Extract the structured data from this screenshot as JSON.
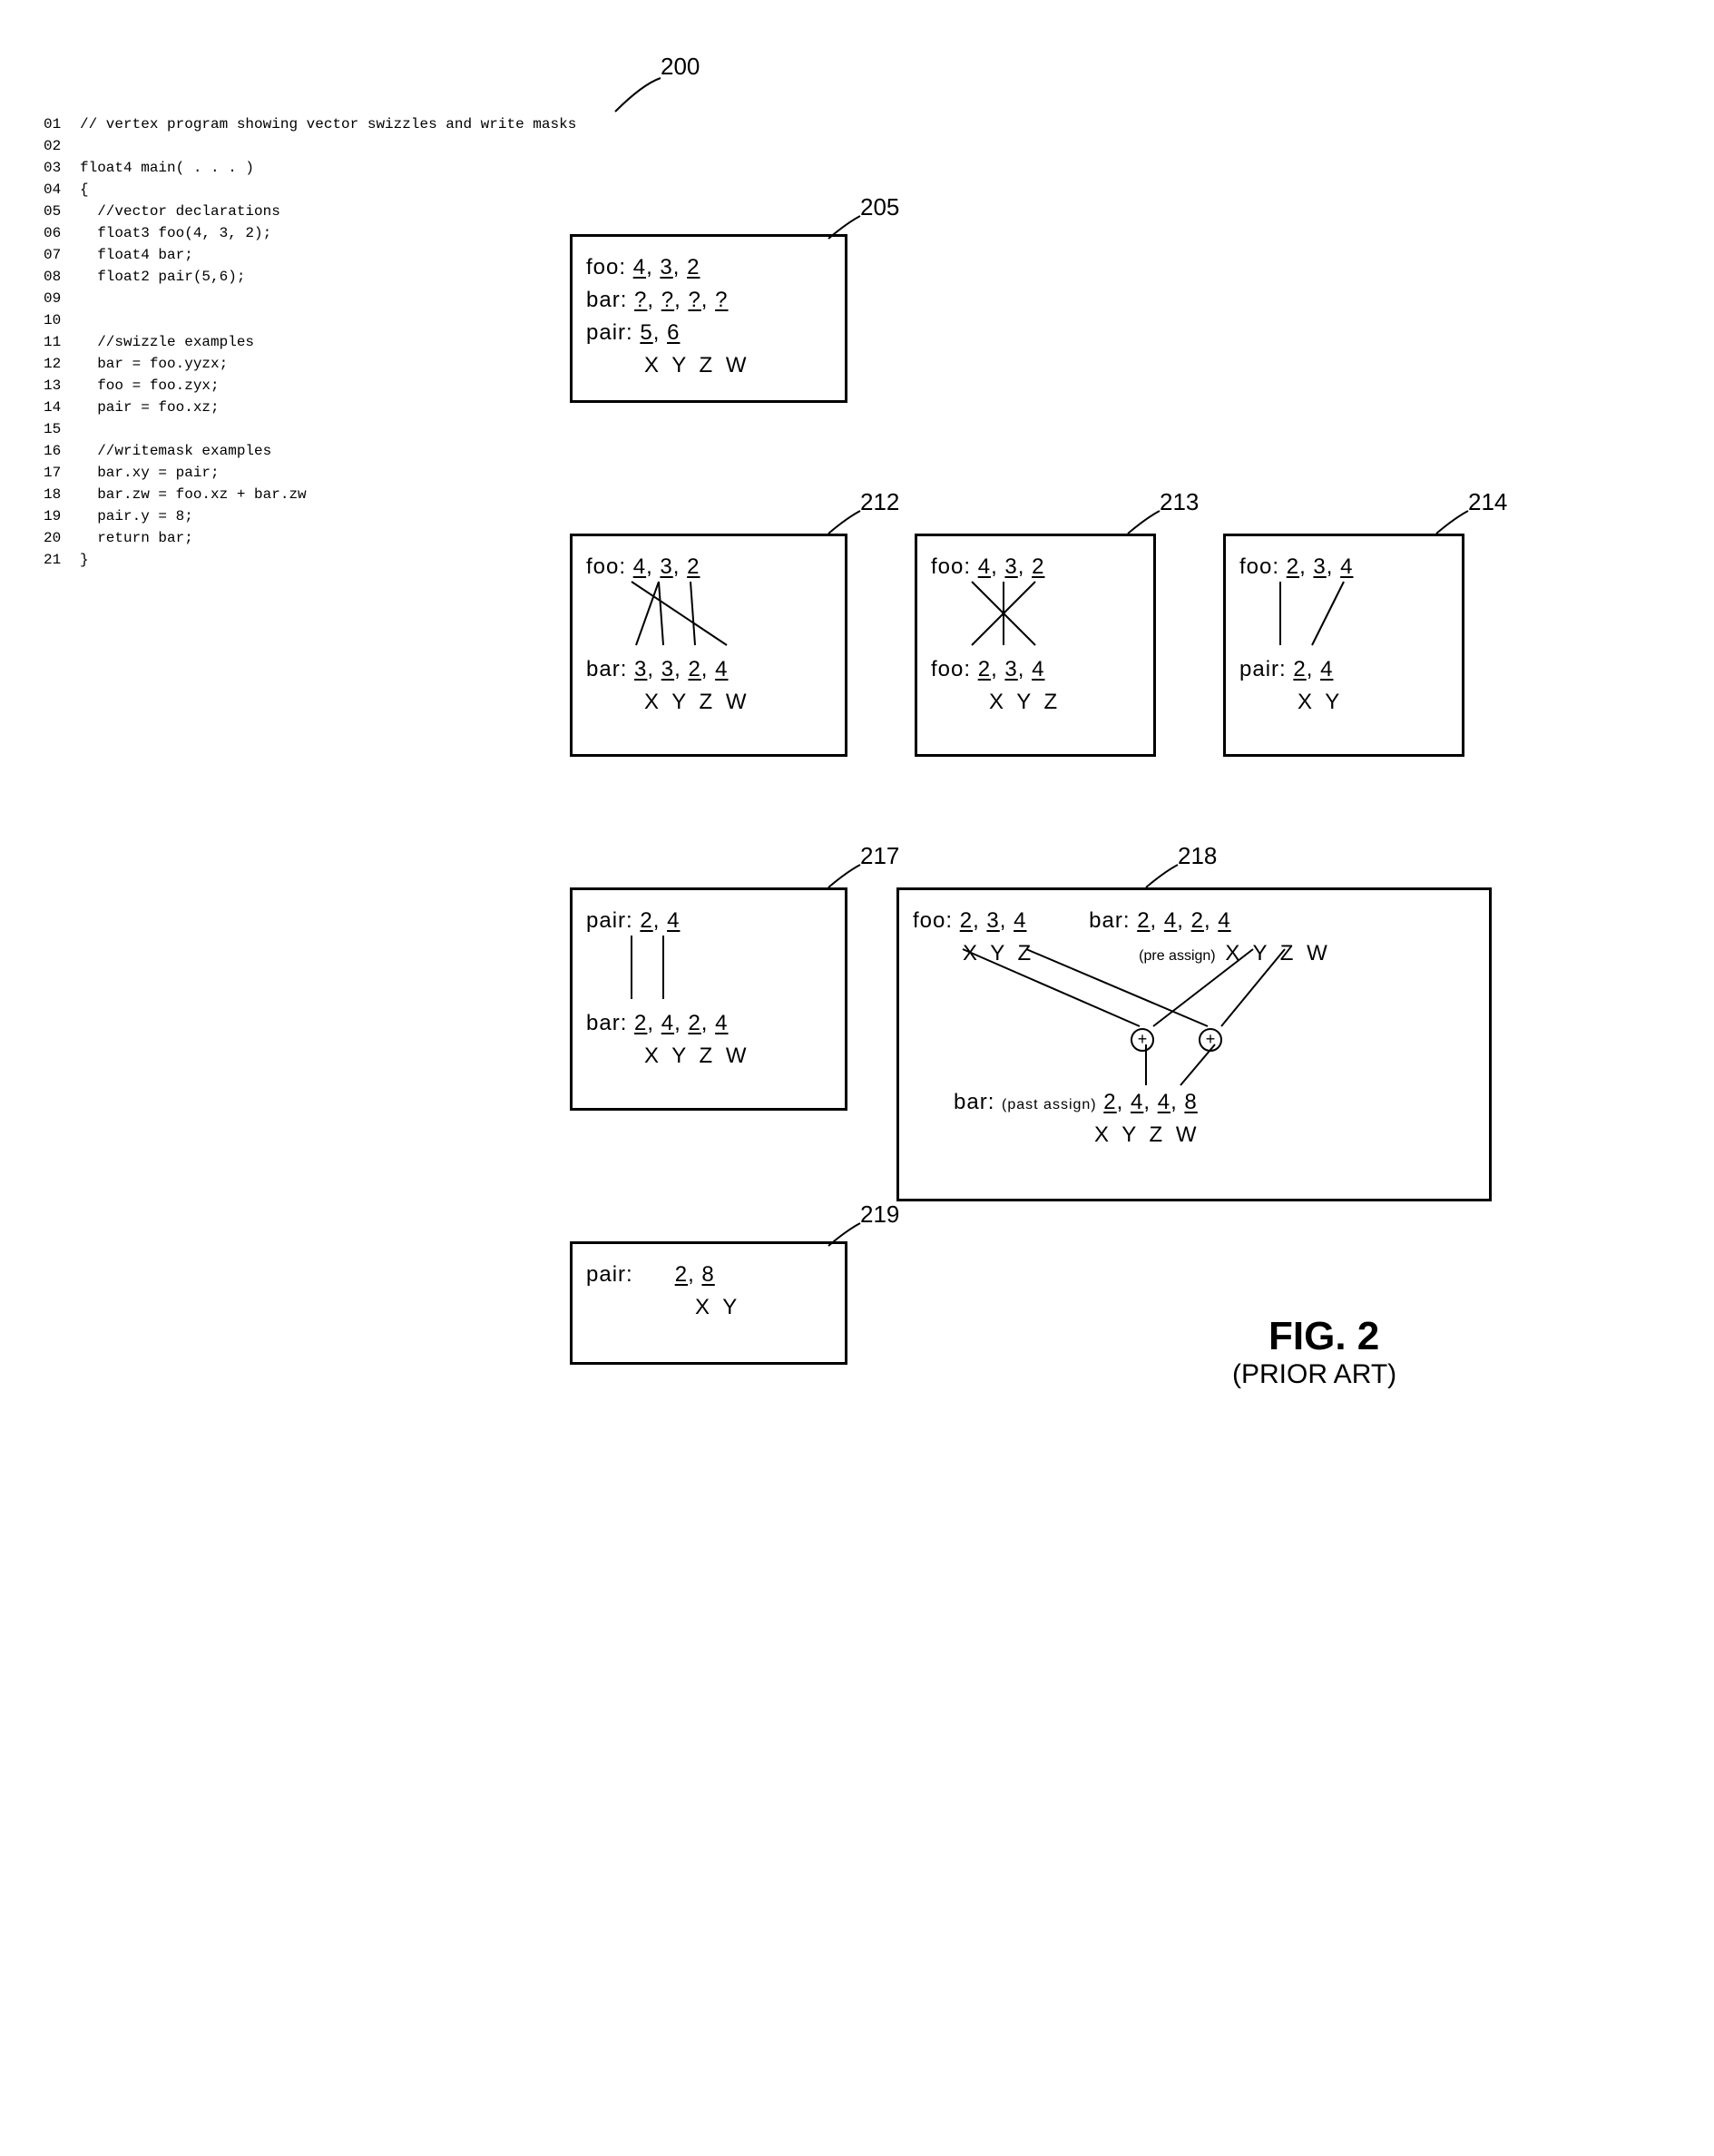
{
  "title_comment": "01  // vertex program showing vector swizzles and write masks",
  "ref_main": "200",
  "code": {
    "lines": [
      {
        "n": "01",
        "t": "// vertex program showing vector swizzles and write masks"
      },
      {
        "n": "02",
        "t": ""
      },
      {
        "n": "03",
        "t": "float4 main( . . . )"
      },
      {
        "n": "04",
        "t": "{"
      },
      {
        "n": "05",
        "t": "  //vector declarations"
      },
      {
        "n": "06",
        "t": "  float3 foo(4, 3, 2);"
      },
      {
        "n": "07",
        "t": "  float4 bar;"
      },
      {
        "n": "08",
        "t": "  float2 pair(5,6);"
      },
      {
        "n": "09",
        "t": ""
      },
      {
        "n": "10",
        "t": ""
      },
      {
        "n": "11",
        "t": "  //swizzle examples"
      },
      {
        "n": "12",
        "t": "  bar = foo.yyzx;"
      },
      {
        "n": "13",
        "t": "  foo = foo.zyx;"
      },
      {
        "n": "14",
        "t": "  pair = foo.xz;"
      },
      {
        "n": "15",
        "t": ""
      },
      {
        "n": "16",
        "t": "  //writemask examples"
      },
      {
        "n": "17",
        "t": "  bar.xy = pair;"
      },
      {
        "n": "18",
        "t": "  bar.zw = foo.xz + bar.zw"
      },
      {
        "n": "19",
        "t": "  pair.y = 8;"
      },
      {
        "n": "20",
        "t": "  return bar;"
      },
      {
        "n": "21",
        "t": "}"
      }
    ]
  },
  "boxes": {
    "b205": {
      "ref": "205",
      "rows": [
        {
          "label": "foo:",
          "vals": [
            "4",
            "3",
            "2"
          ]
        },
        {
          "label": "bar:",
          "vals": [
            "?",
            "?",
            "?",
            "?"
          ]
        },
        {
          "label": "pair:",
          "vals": [
            "5",
            "6"
          ]
        }
      ],
      "comps": "X Y Z W"
    },
    "b212": {
      "ref": "212",
      "top": {
        "label": "foo:",
        "vals": [
          "4",
          "3",
          "2"
        ]
      },
      "bot": {
        "label": "bar:",
        "vals": [
          "3",
          "3",
          "2",
          "4"
        ],
        "comps": "X Y Z W"
      }
    },
    "b213": {
      "ref": "213",
      "top": {
        "label": "foo:",
        "vals": [
          "4",
          "3",
          "2"
        ]
      },
      "bot": {
        "label": "foo:",
        "vals": [
          "2",
          "3",
          "4"
        ],
        "comps": "X Y Z"
      }
    },
    "b214": {
      "ref": "214",
      "top": {
        "label": "foo:",
        "vals": [
          "2",
          "3",
          "4"
        ]
      },
      "bot": {
        "label": "pair:",
        "vals": [
          "2",
          "4"
        ],
        "comps": "X Y"
      }
    },
    "b217": {
      "ref": "217",
      "top": {
        "label": "pair:",
        "vals": [
          "2",
          "4"
        ]
      },
      "bot": {
        "label": "bar:",
        "vals": [
          "2",
          "4",
          "2",
          "4"
        ],
        "comps": "X Y Z W"
      }
    },
    "b218": {
      "ref": "218",
      "foo": {
        "label": "foo:",
        "vals": [
          "2",
          "3",
          "4"
        ],
        "comps": "X Y Z"
      },
      "bar_pre": {
        "label": "bar:",
        "note": "(pre assign)",
        "vals": [
          "2",
          "4",
          "2",
          "4"
        ],
        "comps": "X Y Z W"
      },
      "bar_post": {
        "label": "bar:",
        "note": "(past assign)",
        "vals": [
          "2",
          "4",
          "4",
          "8"
        ],
        "comps": "X Y Z W"
      }
    },
    "b219": {
      "ref": "219",
      "row": {
        "label": "pair:",
        "vals": [
          "2",
          "8"
        ],
        "comps": "X Y"
      }
    }
  },
  "figure": {
    "main": "FIG. 2",
    "sub": "(PRIOR ART)"
  }
}
